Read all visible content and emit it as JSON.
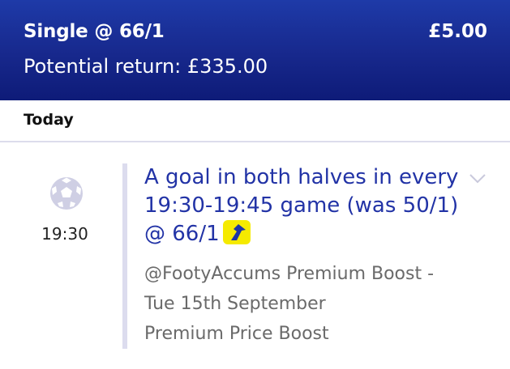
{
  "header": {
    "bet_type": "Single @ 66/1",
    "stake": "£5.00",
    "potential_return": "Potential return: £335.00"
  },
  "day": {
    "label": "Today"
  },
  "event": {
    "sport_icon": "football-icon",
    "time": "19:30",
    "selection_text": "A goal in both halves in every 19:30-19:45 game (was 50/1) @ 66/1",
    "boost_icon": "boost-arrow-icon",
    "expand_icon": "chevron-down-icon",
    "details": [
      "@FootyAccums Premium Boost -",
      "Tue 15th September",
      "Premium Price Boost"
    ]
  },
  "colors": {
    "header_gradient_top": "#1e3aa8",
    "header_gradient_bottom": "#0e1b78",
    "selection_text": "#2233a6",
    "boost_badge": "#f5ea00"
  }
}
